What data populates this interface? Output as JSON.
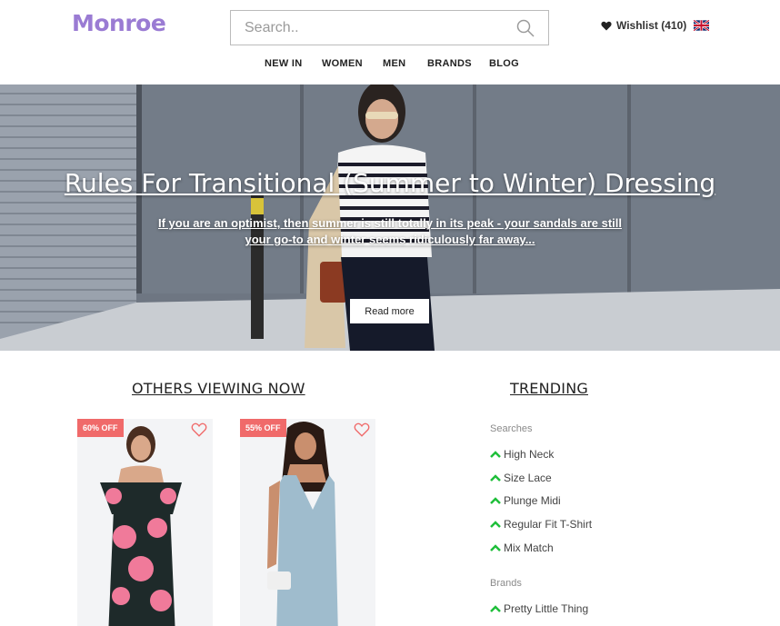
{
  "header": {
    "logo": "Monroe",
    "search_placeholder": "Search..",
    "wishlist_label": "Wishlist (410)"
  },
  "nav": {
    "items": [
      {
        "label": "NEW IN"
      },
      {
        "label": "WOMEN"
      },
      {
        "label": "MEN"
      },
      {
        "label": "BRANDS"
      },
      {
        "label": "BLOG"
      }
    ]
  },
  "hero": {
    "title": "Rules For Transitional (Summer to Winter) Dressing",
    "subtitle": "If you are an optimist, then summer is still totally in its peak - your sandals are still your go-to and winter seems ridiculously far away...",
    "button_label": "Read more"
  },
  "others_viewing": {
    "title": "OTHERS VIEWING NOW",
    "products": [
      {
        "badge": "60% OFF"
      },
      {
        "badge": "55% OFF"
      }
    ]
  },
  "trending": {
    "title": "TRENDING",
    "searches_label": "Searches",
    "searches": [
      "High Neck",
      "Size Lace",
      "Plunge Midi",
      "Regular Fit T-Shirt",
      "Mix Match"
    ],
    "brands_label": "Brands",
    "brands": [
      "Pretty Little Thing"
    ]
  },
  "colors": {
    "brand": "#9a7bd3",
    "badge": "#f06a6a",
    "trend_arrow": "#1fbf3a"
  }
}
